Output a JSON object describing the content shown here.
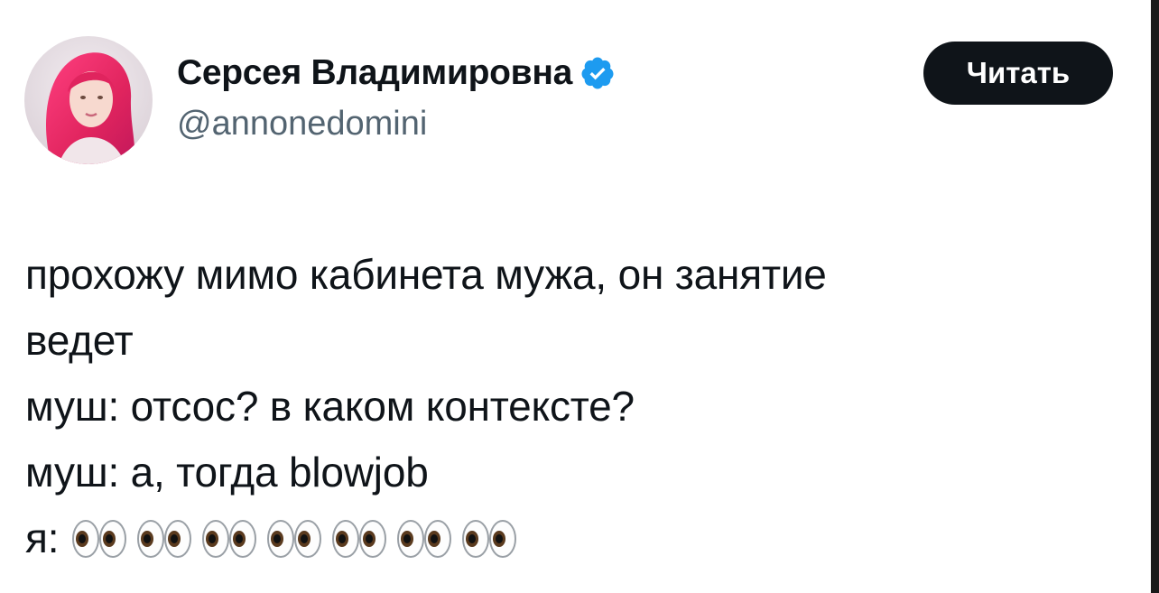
{
  "author": {
    "display_name": "Серсея Владимировна",
    "handle": "@annonedomini",
    "verified": true,
    "avatar_icon": "avatar-pink-hair",
    "verified_color": "#1d9bf0"
  },
  "follow_button": {
    "label": "Читать"
  },
  "tweet": {
    "lines": [
      "прохожу мимо кабинета мужа, он занятие",
      "ведет",
      "муш: отсос? в каком контексте?",
      "муш: а, тогда blowjob"
    ],
    "last_line_prefix": "я:",
    "emoji_icon": "eyes-emoji",
    "emoji_count": 7
  },
  "colors": {
    "text": "#0f1419",
    "secondary": "#536471",
    "button_bg": "#0f1419",
    "button_text": "#ffffff"
  }
}
